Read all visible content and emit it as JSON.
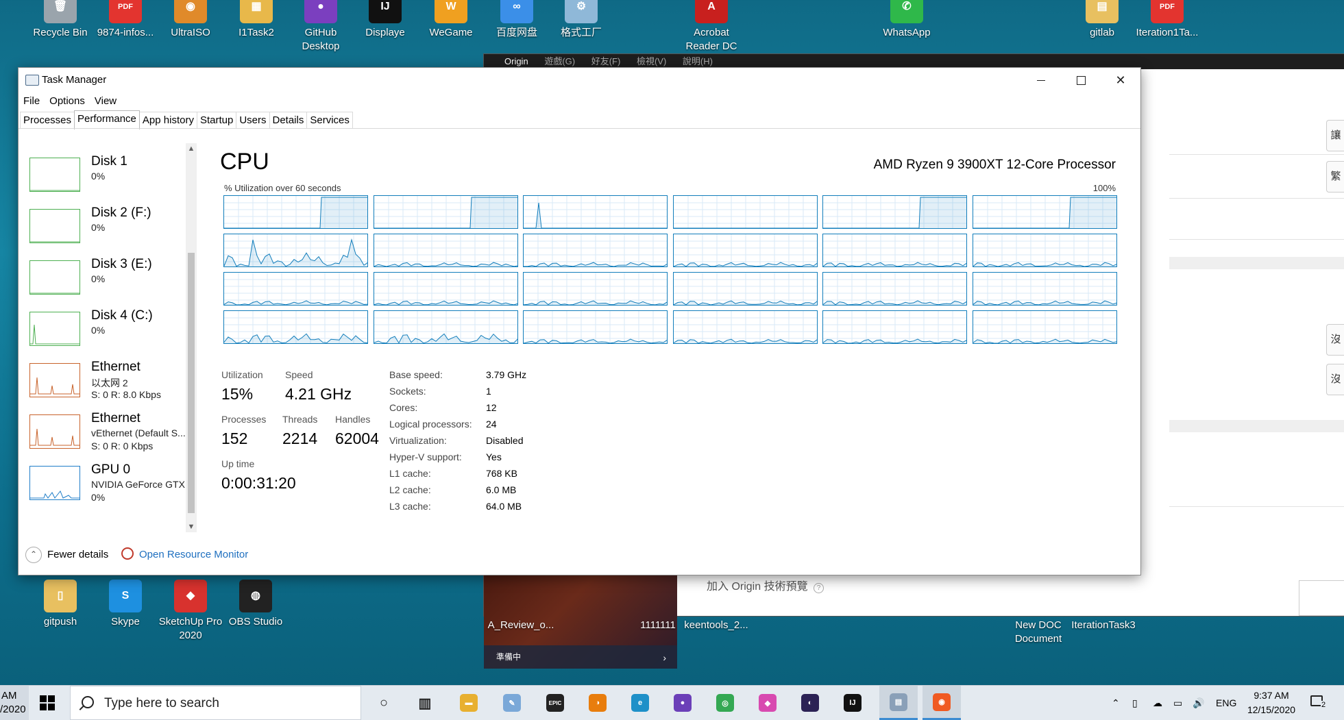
{
  "desktop": {
    "top_icons": [
      {
        "label": "Recycle Bin",
        "name": "recycle-bin-icon",
        "color": "#9aa4ac",
        "glyph": "🗑"
      },
      {
        "label": "9874-infos...",
        "name": "pdf-file-icon",
        "color": "#e3342f",
        "glyph": "PDF"
      },
      {
        "label": "UltraISO",
        "name": "ultraiso-icon",
        "color": "#e08a2a",
        "glyph": "◉"
      },
      {
        "label": "I1Task2",
        "name": "folder-zip-icon",
        "color": "#e8b84a",
        "glyph": "▦"
      },
      {
        "label": "GitHub Desktop",
        "name": "github-desktop-icon",
        "color": "#7b3fbf",
        "glyph": "●"
      },
      {
        "label": "Displaye",
        "name": "intellij-icon",
        "color": "#111111",
        "glyph": "IJ"
      },
      {
        "label": "WeGame",
        "name": "wegame-icon",
        "color": "#f0a020",
        "glyph": "W"
      },
      {
        "label": "百度网盘",
        "name": "baidu-netdisk-icon",
        "color": "#3b8fe8",
        "glyph": "∞"
      },
      {
        "label": "格式工厂",
        "name": "format-factory-icon",
        "color": "#8fb8d8",
        "glyph": "⚙"
      },
      {
        "label": "Acrobat Reader DC",
        "name": "acrobat-reader-icon",
        "color": "#c8201e",
        "glyph": "A"
      },
      {
        "label": "WhatsApp",
        "name": "whatsapp-icon",
        "color": "#2fb84a",
        "glyph": "✆"
      },
      {
        "label": "gitlab",
        "name": "folder-file-icon",
        "color": "#e8c060",
        "glyph": "▤"
      },
      {
        "label": "Iteration1Ta...",
        "name": "pdf-file-icon",
        "color": "#e3342f",
        "glyph": "PDF"
      }
    ],
    "bottom_icons": [
      {
        "label": "gitpush",
        "name": "folder-icon",
        "color": "#e8c060",
        "glyph": "▯"
      },
      {
        "label": "Skype",
        "name": "skype-icon",
        "color": "#1e90e0",
        "glyph": "S"
      },
      {
        "label": "SketchUp Pro 2020",
        "name": "sketchup-icon",
        "color": "#d8322e",
        "glyph": "◆"
      },
      {
        "label": "OBS Studio",
        "name": "obs-studio-icon",
        "color": "#222222",
        "glyph": "◍"
      }
    ],
    "loose_labels": [
      "A_Review_o...",
      "1111111",
      "keentools_2...",
      "New DOC Document",
      "IterationTask3"
    ]
  },
  "origin": {
    "menu": [
      "Origin",
      "遊戲(G)",
      "好友(F)",
      "檢視(V)",
      "說明(H)"
    ],
    "right_buttons": [
      "讓",
      "繁",
      "沒",
      "沒"
    ],
    "game_status": "準備中",
    "tech_preview": "加入 Origin 技術預覽"
  },
  "task_manager": {
    "title": "Task Manager",
    "menu": [
      "File",
      "Options",
      "View"
    ],
    "tabs": [
      "Processes",
      "Performance",
      "App history",
      "Startup",
      "Users",
      "Details",
      "Services"
    ],
    "active_tab": "Performance",
    "sidebar": [
      {
        "title": "Disk 1",
        "sub": "",
        "value": "0%",
        "kind": "disk"
      },
      {
        "title": "Disk 2 (F:)",
        "sub": "",
        "value": "0%",
        "kind": "disk"
      },
      {
        "title": "Disk 3 (E:)",
        "sub": "",
        "value": "0%",
        "kind": "disk"
      },
      {
        "title": "Disk 4 (C:)",
        "sub": "",
        "value": "0%",
        "kind": "disk"
      },
      {
        "title": "Ethernet",
        "sub": "以太网 2",
        "value": "S: 0 R: 8.0 Kbps",
        "kind": "net"
      },
      {
        "title": "Ethernet",
        "sub": "vEthernet (Default S...",
        "value": "S: 0 R: 0 Kbps",
        "kind": "net"
      },
      {
        "title": "GPU 0",
        "sub": "NVIDIA GeForce GTX",
        "value": "0%",
        "kind": "gpu"
      }
    ],
    "main": {
      "title": "CPU",
      "processor": "AMD Ryzen 9 3900XT 12-Core Processor",
      "util_label": "% Utilization over 60 seconds",
      "util_max": "100%",
      "stats": {
        "utilization_label": "Utilization",
        "utilization": "15%",
        "speed_label": "Speed",
        "speed": "4.21 GHz",
        "processes_label": "Processes",
        "processes": "152",
        "threads_label": "Threads",
        "threads": "2214",
        "handles_label": "Handles",
        "handles": "62004",
        "uptime_label": "Up time",
        "uptime": "0:00:31:20"
      },
      "details": [
        {
          "label": "Base speed:",
          "value": "3.79 GHz"
        },
        {
          "label": "Sockets:",
          "value": "1"
        },
        {
          "label": "Cores:",
          "value": "12"
        },
        {
          "label": "Logical processors:",
          "value": "24"
        },
        {
          "label": "Virtualization:",
          "value": "Disabled"
        },
        {
          "label": "Hyper-V support:",
          "value": "Yes"
        },
        {
          "label": "L1 cache:",
          "value": "768 KB"
        },
        {
          "label": "L2 cache:",
          "value": "6.0 MB"
        },
        {
          "label": "L3 cache:",
          "value": "64.0 MB"
        }
      ]
    },
    "footer": {
      "fewer_details": "Fewer details",
      "open_resource_monitor": "Open Resource Monitor"
    }
  },
  "taskbar": {
    "left_clip_top": "AM",
    "left_clip_bottom": "/2020",
    "search_placeholder": "Type here to search",
    "apps": [
      {
        "name": "cortana-icon",
        "color": "#222222",
        "glyph": "○"
      },
      {
        "name": "task-view-icon",
        "color": "#222222",
        "glyph": "▥"
      },
      {
        "name": "file-explorer-icon",
        "color": "#e8b030",
        "glyph": "▬"
      },
      {
        "name": "paint-icon",
        "color": "#7aa8d8",
        "glyph": "✎"
      },
      {
        "name": "epic-games-icon",
        "color": "#222222",
        "glyph": "EPIC"
      },
      {
        "name": "blender-icon",
        "color": "#e87d0d",
        "glyph": "◑"
      },
      {
        "name": "edge-icon",
        "color": "#1e90c8",
        "glyph": "e"
      },
      {
        "name": "github-icon",
        "color": "#6b3fb8",
        "glyph": "●"
      },
      {
        "name": "chrome-icon",
        "color": "#34a853",
        "glyph": "◎"
      },
      {
        "name": "kite-icon",
        "color": "#d84ab0",
        "glyph": "◆"
      },
      {
        "name": "eclipse-icon",
        "color": "#2c2255",
        "glyph": "◐"
      },
      {
        "name": "intellij-icon",
        "color": "#111111",
        "glyph": "IJ"
      },
      {
        "name": "task-manager-icon",
        "color": "#8aa0b8",
        "glyph": "▤"
      },
      {
        "name": "origin-icon",
        "color": "#f05a22",
        "glyph": "◉"
      }
    ],
    "tray_lang": "ENG",
    "time": "9:37 AM",
    "date": "12/15/2020",
    "notification_count": "2"
  }
}
